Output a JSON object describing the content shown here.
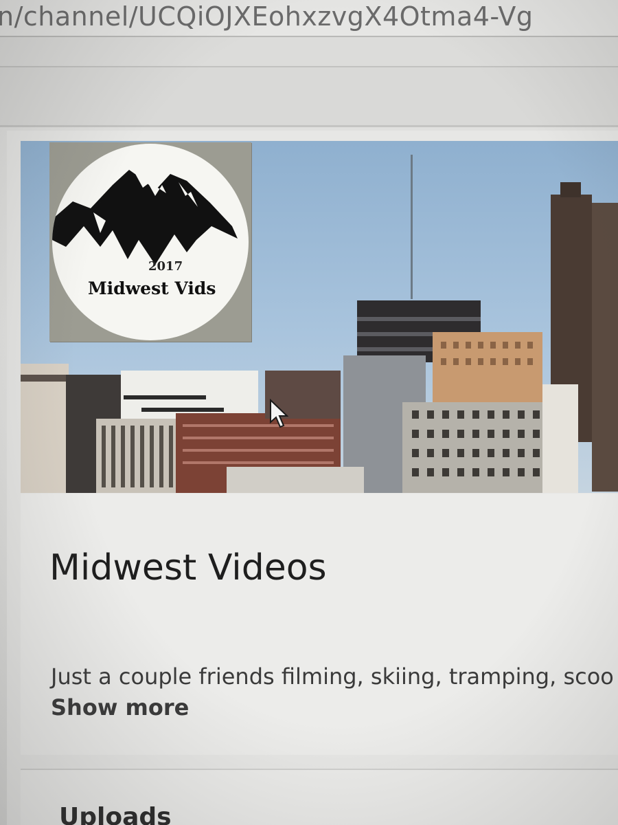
{
  "browser": {
    "url_fragment": "n/channel/UCQiOJXEohxzvgX4Otma4-Vg"
  },
  "channel": {
    "avatar": {
      "year": "2017",
      "name": "Midwest Vids"
    },
    "title": "Midwest Videos",
    "description": "Just a couple friends filming, skiing, tramping, scoo",
    "show_more_label": "Show more"
  },
  "sections": {
    "uploads_heading": "Uploads"
  },
  "colors": {
    "sky": "#9dbbd6",
    "card_background": "#ececea",
    "title_text": "#1e1e1e"
  }
}
